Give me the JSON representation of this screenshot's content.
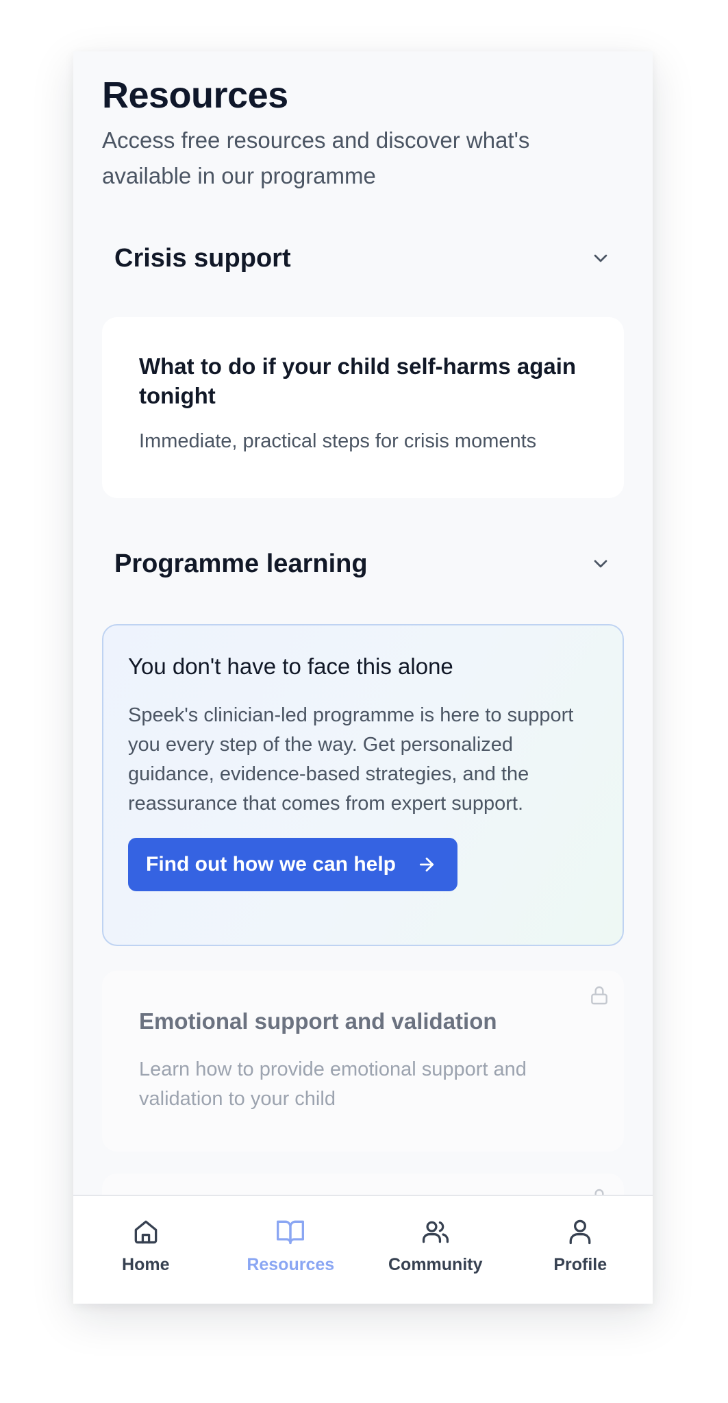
{
  "header": {
    "title": "Resources",
    "subtitle": "Access free resources and discover what's available in our programme"
  },
  "sections": [
    {
      "title": "Crisis support",
      "icon": "chevron-down-icon"
    },
    {
      "title": "Programme learning",
      "icon": "chevron-down-icon"
    }
  ],
  "crisis_card": {
    "title": "What to do if your child self-harms again tonight",
    "description": "Immediate, practical steps for crisis moments"
  },
  "promo_card": {
    "title": "You don't have to face this alone",
    "body": "Speek's clinician-led programme is here to support you every step of the way. Get personalized guidance, evidence-based strategies, and the reassurance that comes from expert support.",
    "cta_label": "Find out how we can help",
    "cta_icon": "arrow-right-icon"
  },
  "locked_cards": [
    {
      "title": "Emotional support and validation",
      "description": "Learn how to provide emotional support and validation to your child",
      "icon": "lock-icon"
    },
    {
      "icon": "lock-icon"
    }
  ],
  "nav": {
    "items": [
      {
        "label": "Home",
        "icon": "home-icon",
        "active": false
      },
      {
        "label": "Resources",
        "icon": "book-open-icon",
        "active": true
      },
      {
        "label": "Community",
        "icon": "users-icon",
        "active": false
      },
      {
        "label": "Profile",
        "icon": "user-icon",
        "active": false
      }
    ]
  },
  "colors": {
    "primary": "#3563e2",
    "nav_active": "#8aa6f3",
    "promo_border": "#bfd3f2",
    "text_primary": "#111827",
    "text_secondary": "#4b5563"
  }
}
